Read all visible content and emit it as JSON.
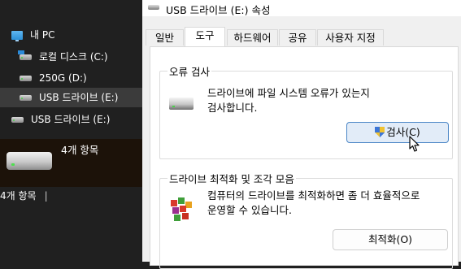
{
  "explorer": {
    "nav": [
      {
        "label": "내 PC",
        "icon": "pc-icon"
      },
      {
        "label": "로컬 디스크 (C:)",
        "icon": "windows-drive-icon"
      },
      {
        "label": "250G (D:)",
        "icon": "drive-icon"
      },
      {
        "label": "USB 드라이브 (E:)",
        "icon": "drive-icon",
        "selected": true
      },
      {
        "label": "USB 드라이브 (E:)",
        "icon": "drive-icon"
      }
    ],
    "selected_panel": {
      "count": "4개 항목",
      "icon": "drive-icon"
    },
    "status_bar": {
      "count": "4개 항목",
      "separator": "|"
    }
  },
  "dialog": {
    "title": "USB 드라이브 (E:) 속성",
    "title_icon": "drive-icon",
    "tabs": [
      {
        "label": "일반"
      },
      {
        "label": "도구",
        "active": true
      },
      {
        "label": "하드웨어"
      },
      {
        "label": "공유"
      },
      {
        "label": "사용자 지정"
      }
    ],
    "error_check": {
      "title": "오류 검사",
      "description_line1": "드라이브에 파일 시스템 오류가 있는지",
      "description_line2": "검사합니다.",
      "button_label": "검사(C)",
      "button_icon": "uac-shield-icon"
    },
    "optimize": {
      "title": "드라이브 최적화 및 조각 모음",
      "description_line1": "컴퓨터의 드라이브를 최적화하면 좀 더 효율적으로",
      "description_line2": "운영할 수 있습니다.",
      "button_label": "최적화(O)",
      "icon": "defrag-icon"
    }
  },
  "colors": {
    "explorer_bg": "#202020",
    "selected_bg": "#3b3b3b",
    "dialog_bg": "#f0f0f0",
    "primary_button_border": "#4b86c6"
  }
}
